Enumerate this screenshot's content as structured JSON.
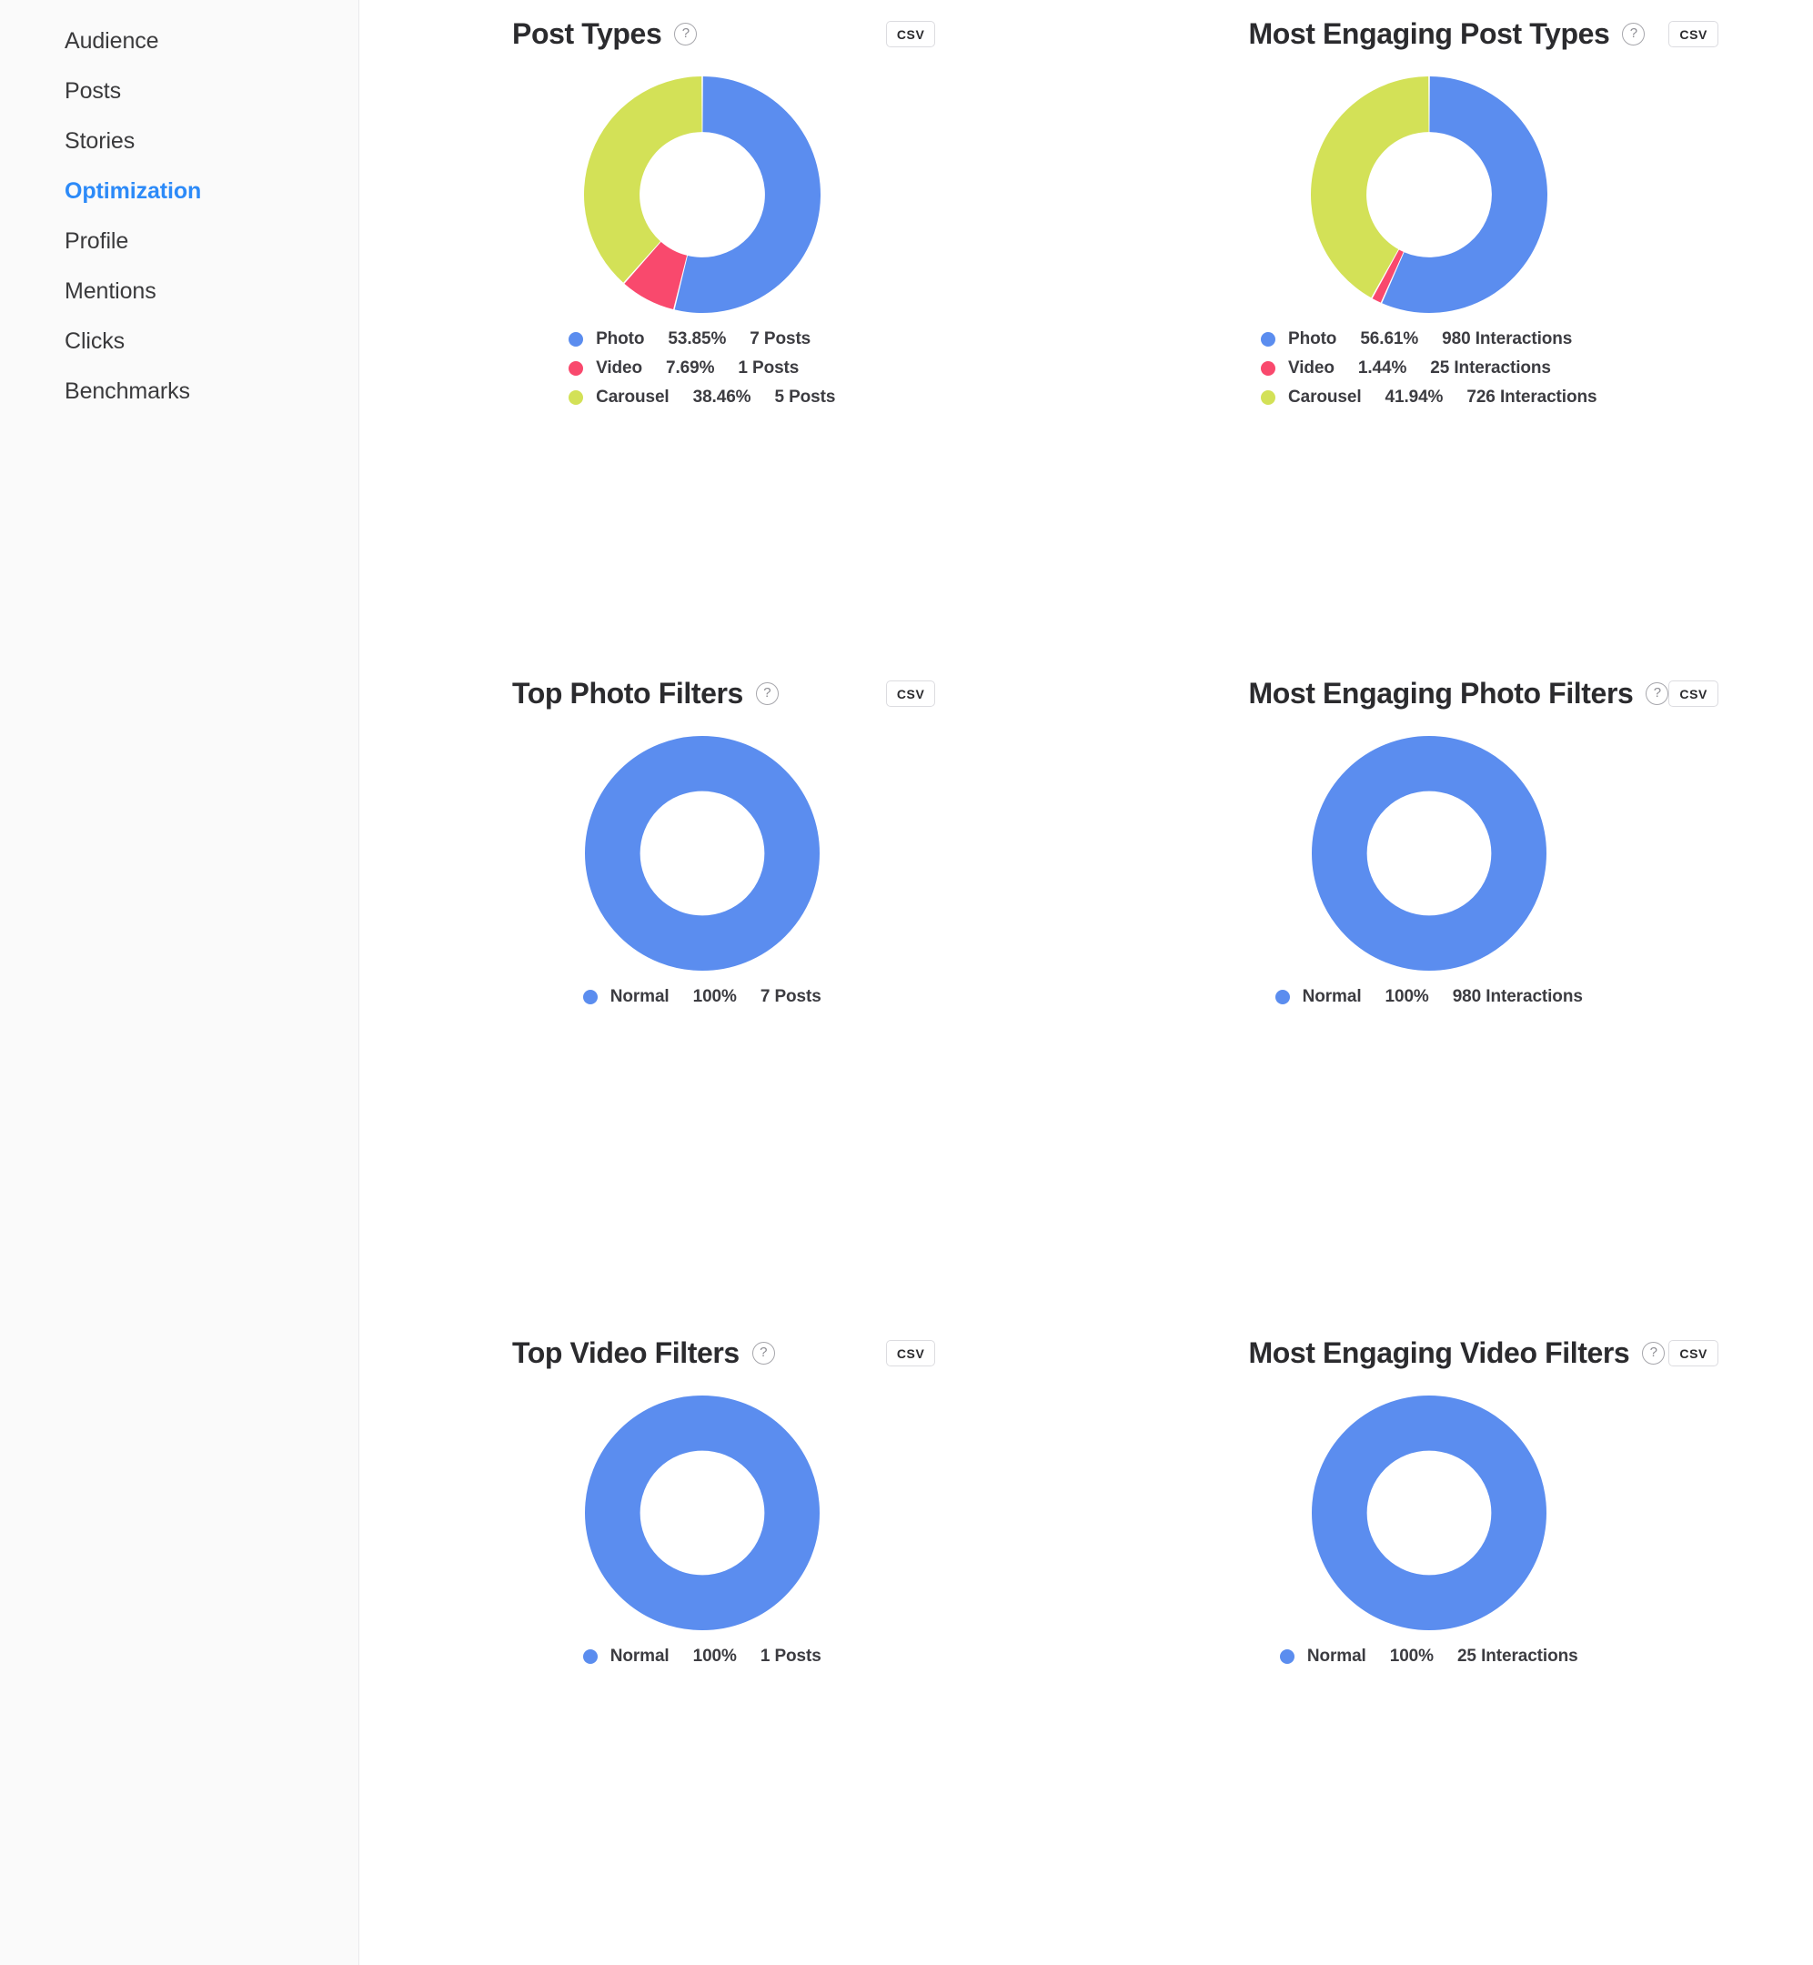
{
  "sidebar": {
    "items": [
      {
        "label": "Audience",
        "active": false
      },
      {
        "label": "Posts",
        "active": false
      },
      {
        "label": "Stories",
        "active": false
      },
      {
        "label": "Optimization",
        "active": true
      },
      {
        "label": "Profile",
        "active": false
      },
      {
        "label": "Mentions",
        "active": false
      },
      {
        "label": "Clicks",
        "active": false
      },
      {
        "label": "Benchmarks",
        "active": false
      }
    ]
  },
  "common": {
    "csv_label": "CSV",
    "help_glyph": "?"
  },
  "colors": {
    "photo": "#5b8def",
    "video": "#f9496d",
    "carousel": "#d3e157",
    "accent": "#2c8af8",
    "sidebar_bg": "#fafafa",
    "text": "#2b2b2e"
  },
  "panels": [
    {
      "id": "post-types",
      "title": "Post Types",
      "legend": [
        {
          "label": "Photo",
          "pct": "53.85%",
          "count": "7 Posts",
          "color": "#5b8def"
        },
        {
          "label": "Video",
          "pct": "7.69%",
          "count": "1 Posts",
          "color": "#f9496d"
        },
        {
          "label": "Carousel",
          "pct": "38.46%",
          "count": "5 Posts",
          "color": "#d3e157"
        }
      ]
    },
    {
      "id": "most-engaging-post-types",
      "title": "Most Engaging Post Types",
      "legend": [
        {
          "label": "Photo",
          "pct": "56.61%",
          "count": "980 Interactions",
          "color": "#5b8def"
        },
        {
          "label": "Video",
          "pct": "1.44%",
          "count": "25 Interactions",
          "color": "#f9496d"
        },
        {
          "label": "Carousel",
          "pct": "41.94%",
          "count": "726 Interactions",
          "color": "#d3e157"
        }
      ]
    },
    {
      "id": "top-photo-filters",
      "title": "Top Photo Filters",
      "legend": [
        {
          "label": "Normal",
          "pct": "100%",
          "count": "7 Posts",
          "color": "#5b8def"
        }
      ]
    },
    {
      "id": "most-engaging-photo-filters",
      "title": "Most Engaging Photo Filters",
      "legend": [
        {
          "label": "Normal",
          "pct": "100%",
          "count": "980 Interactions",
          "color": "#5b8def"
        }
      ]
    },
    {
      "id": "top-video-filters",
      "title": "Top Video Filters",
      "legend": [
        {
          "label": "Normal",
          "pct": "100%",
          "count": "1 Posts",
          "color": "#5b8def"
        }
      ]
    },
    {
      "id": "most-engaging-video-filters",
      "title": "Most Engaging Video Filters",
      "legend": [
        {
          "label": "Normal",
          "pct": "100%",
          "count": "25 Interactions",
          "color": "#5b8def"
        }
      ]
    }
  ],
  "chart_data": [
    {
      "type": "pie",
      "title": "Post Types",
      "donut": true,
      "unit": "Posts",
      "categories": [
        "Photo",
        "Video",
        "Carousel"
      ],
      "values": [
        7,
        1,
        5
      ],
      "percentages": [
        53.85,
        7.69,
        38.46
      ],
      "colors": [
        "#5b8def",
        "#f9496d",
        "#d3e157"
      ],
      "legend_position": "bottom"
    },
    {
      "type": "pie",
      "title": "Most Engaging Post Types",
      "donut": true,
      "unit": "Interactions",
      "categories": [
        "Photo",
        "Video",
        "Carousel"
      ],
      "values": [
        980,
        25,
        726
      ],
      "percentages": [
        56.61,
        1.44,
        41.94
      ],
      "colors": [
        "#5b8def",
        "#f9496d",
        "#d3e157"
      ],
      "legend_position": "bottom"
    },
    {
      "type": "pie",
      "title": "Top Photo Filters",
      "donut": true,
      "unit": "Posts",
      "categories": [
        "Normal"
      ],
      "values": [
        7
      ],
      "percentages": [
        100
      ],
      "colors": [
        "#5b8def"
      ],
      "legend_position": "bottom"
    },
    {
      "type": "pie",
      "title": "Most Engaging Photo Filters",
      "donut": true,
      "unit": "Interactions",
      "categories": [
        "Normal"
      ],
      "values": [
        980
      ],
      "percentages": [
        100
      ],
      "colors": [
        "#5b8def"
      ],
      "legend_position": "bottom"
    },
    {
      "type": "pie",
      "title": "Top Video Filters",
      "donut": true,
      "unit": "Posts",
      "categories": [
        "Normal"
      ],
      "values": [
        1
      ],
      "percentages": [
        100
      ],
      "colors": [
        "#5b8def"
      ],
      "legend_position": "bottom"
    },
    {
      "type": "pie",
      "title": "Most Engaging Video Filters",
      "donut": true,
      "unit": "Interactions",
      "categories": [
        "Normal"
      ],
      "values": [
        25
      ],
      "percentages": [
        100
      ],
      "colors": [
        "#5b8def"
      ],
      "legend_position": "bottom"
    }
  ]
}
